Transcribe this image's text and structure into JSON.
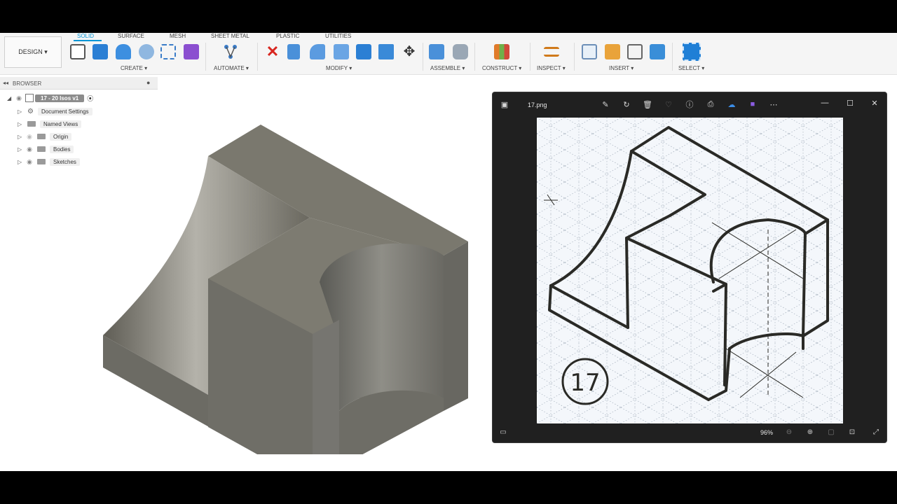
{
  "app": {
    "workspace_button": "DESIGN ▾",
    "tabs": [
      "SOLID",
      "SURFACE",
      "MESH",
      "SHEET METAL",
      "PLASTIC",
      "UTILITIES"
    ],
    "active_tab": "SOLID",
    "groups": {
      "create": "CREATE ▾",
      "automate": "AUTOMATE ▾",
      "modify": "MODIFY ▾",
      "assemble": "ASSEMBLE ▾",
      "construct": "CONSTRUCT ▾",
      "inspect": "INSPECT ▾",
      "insert": "INSERT ▾",
      "select": "SELECT ▾"
    }
  },
  "browser": {
    "title": "BROWSER",
    "root": "17 - 20 Isos v1",
    "items": [
      "Document Settings",
      "Named Views",
      "Origin",
      "Bodies",
      "Sketches"
    ]
  },
  "viewer": {
    "filename": "17.png",
    "zoom": "96%",
    "drawing_number": "17"
  },
  "colors": {
    "accent": "#0696d7",
    "model_face_front": "#6e6e68",
    "model_face_top": "#76746a",
    "viewer_bg": "#202020"
  }
}
